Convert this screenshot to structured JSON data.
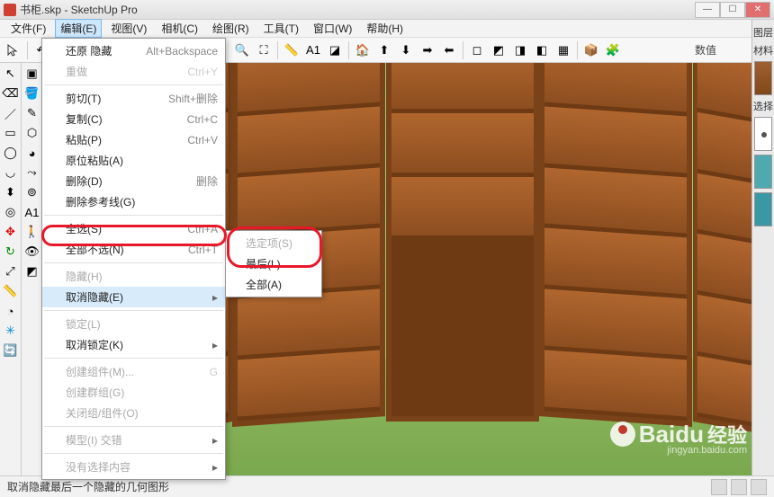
{
  "window": {
    "title": "书柜.skp - SketchUp Pro"
  },
  "menubar": {
    "items": [
      "文件(F)",
      "编辑(E)",
      "视图(V)",
      "相机(C)",
      "绘图(R)",
      "工具(T)",
      "窗口(W)",
      "帮助(H)"
    ],
    "open_index": 1
  },
  "toolbar": {
    "value_label": "数值"
  },
  "edit_menu": [
    {
      "label": "还原 隐藏",
      "shortcut": "Alt+Backspace"
    },
    {
      "label": "重做",
      "shortcut": "Ctrl+Y",
      "disabled": true
    },
    {
      "sep": true
    },
    {
      "label": "剪切(T)",
      "shortcut": "Shift+删除"
    },
    {
      "label": "复制(C)",
      "shortcut": "Ctrl+C"
    },
    {
      "label": "粘贴(P)",
      "shortcut": "Ctrl+V"
    },
    {
      "label": "原位粘贴(A)"
    },
    {
      "label": "删除(D)",
      "shortcut": "删除"
    },
    {
      "label": "删除参考线(G)"
    },
    {
      "sep": true
    },
    {
      "label": "全选(S)",
      "shortcut": "Ctrl+A"
    },
    {
      "label": "全部不选(N)",
      "shortcut": "Ctrl+T"
    },
    {
      "sep": true
    },
    {
      "label": "隐藏(H)",
      "disabled": true
    },
    {
      "label": "取消隐藏(E)",
      "submenu": true,
      "hi": true
    },
    {
      "sep": true
    },
    {
      "label": "锁定(L)",
      "disabled": true
    },
    {
      "label": "取消锁定(K)",
      "submenu": true
    },
    {
      "sep": true
    },
    {
      "label": "创建组件(M)...",
      "shortcut": "G",
      "disabled": true
    },
    {
      "label": "创建群组(G)",
      "disabled": true
    },
    {
      "label": "关闭组/组件(O)",
      "disabled": true
    },
    {
      "sep": true
    },
    {
      "label": "模型(I) 交错",
      "submenu": true,
      "disabled": true
    },
    {
      "sep": true
    },
    {
      "label": "没有选择内容",
      "submenu": true,
      "disabled": true
    }
  ],
  "unhide_submenu": [
    {
      "label": "选定项(S)",
      "disabled": true
    },
    {
      "label": "最后(L)"
    },
    {
      "label": "全部(A)"
    }
  ],
  "right_panel": {
    "h1": "图层",
    "h2": "材料",
    "h3": "选择"
  },
  "statusbar": {
    "text": "取消隐藏最后一个隐藏的几何图形"
  },
  "watermark": {
    "brand": "Baidu",
    "sub": "经验",
    "url": "jingyan.baidu.com"
  }
}
